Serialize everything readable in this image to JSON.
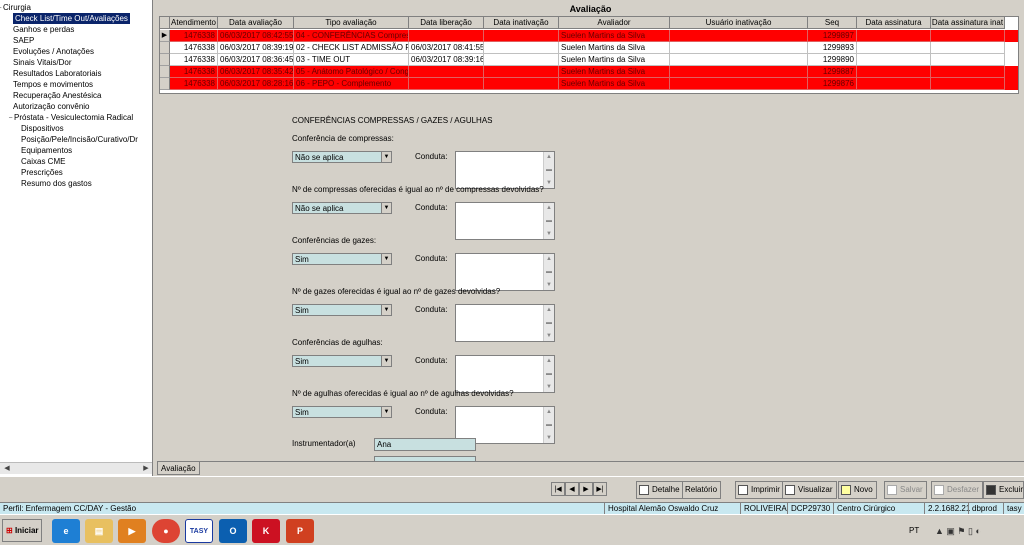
{
  "tree": {
    "items": [
      {
        "label": "Cirurgia",
        "level": 0,
        "expander": "−"
      },
      {
        "label": "Check List/Time Out/Avaliações",
        "level": 1,
        "selected": true
      },
      {
        "label": "Ganhos e perdas",
        "level": 1
      },
      {
        "label": "SAEP",
        "level": 1
      },
      {
        "label": "Evoluções / Anotações",
        "level": 1
      },
      {
        "label": "Sinais Vitais/Dor",
        "level": 1
      },
      {
        "label": "Resultados Laboratoriais",
        "level": 1
      },
      {
        "label": "Tempos e movimentos",
        "level": 1
      },
      {
        "label": "Recuperação Anestésica",
        "level": 1
      },
      {
        "label": "Autorização convênio",
        "level": 1
      },
      {
        "label": "Próstata - Vesiculectomia Radical",
        "level": 1,
        "expander": "−"
      },
      {
        "label": "Dispositivos",
        "level": 2
      },
      {
        "label": "Posição/Pele/Incisão/Curativo/Dr",
        "level": 2
      },
      {
        "label": "Equipamentos",
        "level": 2
      },
      {
        "label": "Caixas CME",
        "level": 2
      },
      {
        "label": "Prescrições",
        "level": 2
      },
      {
        "label": "Resumo dos gastos",
        "level": 2
      }
    ]
  },
  "panel": {
    "title": "Avaliação"
  },
  "grid": {
    "columns": [
      "Atendimento",
      "Data avaliação",
      "Tipo avaliação",
      "Data liberação",
      "Data inativação",
      "Avaliador",
      "Usuário inativação",
      "Seq",
      "Data assinatura",
      "Data assinatura inat"
    ],
    "rows": [
      {
        "red": true,
        "current": true,
        "cells": [
          "1476338",
          "06/03/2017 08:42:55",
          "04 - CONFERÊNCIAS Compressas",
          "",
          "",
          "Suelen Martins da Silva",
          "",
          "1299897",
          "",
          ""
        ]
      },
      {
        "red": false,
        "cells": [
          "1476338",
          "06/03/2017 08:39:19",
          "02 - CHECK LIST ADMISSÃO PACI",
          "06/03/2017 08:41:55",
          "",
          "Suelen Martins da Silva",
          "",
          "1299893",
          "",
          ""
        ]
      },
      {
        "red": false,
        "cells": [
          "1476338",
          "06/03/2017 08:36:45",
          "03 - TIME OUT",
          "06/03/2017 08:39:16",
          "",
          "Suelen Martins da Silva",
          "",
          "1299890",
          "",
          ""
        ]
      },
      {
        "red": true,
        "cells": [
          "1476338",
          "06/03/2017 08:35:42",
          "05 - Anátomo Patológico / Congela",
          "",
          "",
          "Suelen Martins da Silva",
          "",
          "1299887",
          "",
          ""
        ]
      },
      {
        "red": true,
        "cells": [
          "1476338",
          "06/03/2017 08:28:16",
          "06 - PEPO - Complemento",
          "",
          "",
          "Suelen Martins da Silva",
          "",
          "1299876",
          "",
          ""
        ]
      }
    ]
  },
  "form": {
    "section_title": "CONFERÊNCIAS COMPRESSAS / GAZES / AGULHAS",
    "conduta_label": "Conduta:",
    "questions": [
      {
        "label": "Conferência de compressas:",
        "value": "Não se aplica"
      },
      {
        "label": "Nº de compressas oferecidas é igual ao nº de compressas devolvidas?",
        "value": "Não se aplica"
      },
      {
        "label": "Conferências de gazes:",
        "value": "Sim"
      },
      {
        "label": "Nº de gazes oferecidas é igual ao nº de gazes devolvidas?",
        "value": "Sim"
      },
      {
        "label": "Conferências de agulhas:",
        "value": "Sim"
      },
      {
        "label": "Nº de agulhas oferecidas é igual ao nº de agulhas devolvidas?",
        "value": "Sim"
      }
    ],
    "instrumentador_label": "Instrumentador(a)",
    "instrumentador_value": "Ana"
  },
  "tabs": {
    "avaliacao": "Avaliação"
  },
  "toolbar": {
    "detalhe": "Detalhe",
    "relatorio": "Relatório",
    "imprimir": "Imprimir",
    "visualizar": "Visualizar",
    "novo": "Novo",
    "salvar": "Salvar",
    "desfazer": "Desfazer",
    "excluir": "Excluir"
  },
  "statusbar": {
    "perfil": "Perfil: Enfermagem CC/DAY - Gestão",
    "hospital": "Hospital Alemão Oswaldo Cruz",
    "user": "ROLIVEIRA",
    "machine": "DCP29730",
    "sector": "Centro Cirúrgico",
    "version": "2.2.1682.21",
    "db": "dbprod",
    "app": "tasy"
  },
  "taskbar": {
    "start": "Iniciar",
    "lang": "PT",
    "apps": [
      "ie-icon",
      "file-explorer-icon",
      "media-player-icon",
      "chrome-icon",
      "tasy-icon",
      "outlook-icon",
      "kaspersky-icon",
      "powerpoint-icon"
    ]
  }
}
